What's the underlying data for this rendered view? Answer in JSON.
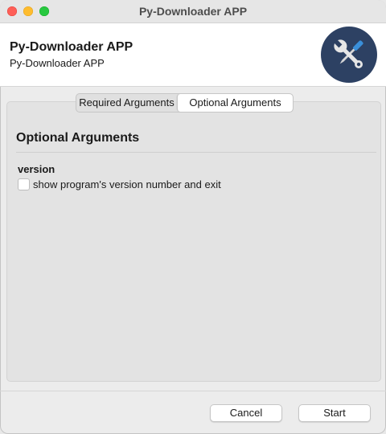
{
  "window": {
    "title": "Py-Downloader APP",
    "controls": [
      "close",
      "minimize",
      "maximize"
    ]
  },
  "header": {
    "title": "Py-Downloader APP",
    "subtitle": "Py-Downloader APP",
    "logo_icon": "wrench-screwdriver-icon",
    "logo_bg": "#2d4163"
  },
  "tabs": [
    {
      "label": "Required Arguments",
      "selected": false
    },
    {
      "label": "Optional Arguments",
      "selected": true
    }
  ],
  "section": {
    "title": "Optional Arguments",
    "args": [
      {
        "name": "version",
        "help": "show program's version number and exit",
        "checked": false
      }
    ]
  },
  "footer": {
    "cancel_label": "Cancel",
    "start_label": "Start"
  }
}
